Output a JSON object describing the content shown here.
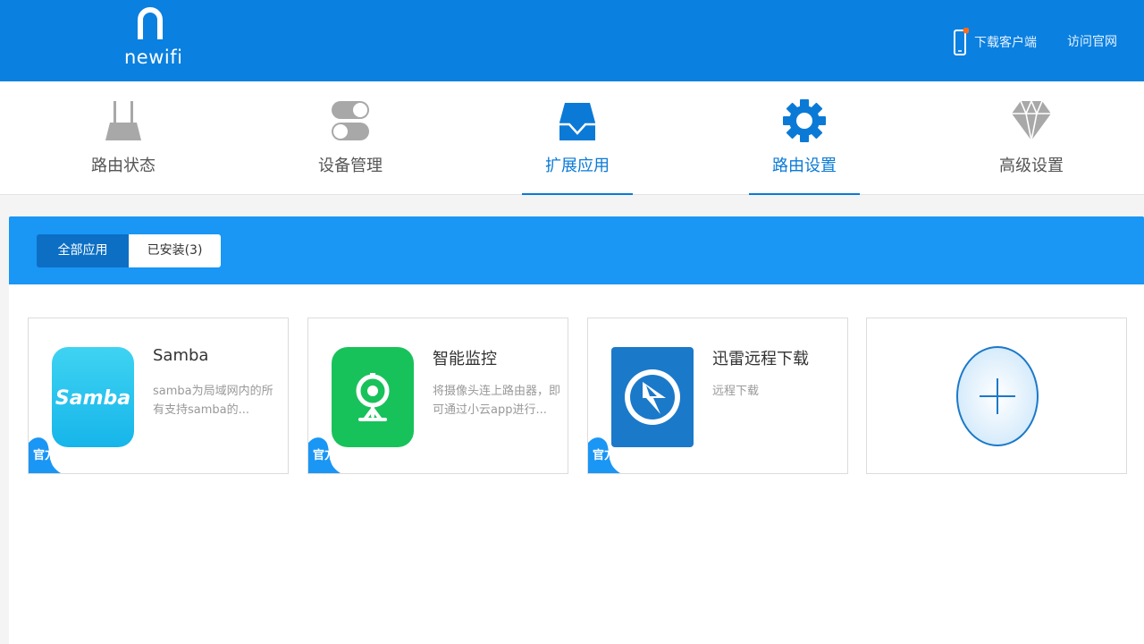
{
  "header": {
    "logo_text": "newifi",
    "download_client": "下载客户端",
    "official_site": "访问官网",
    "bg_color": "#0a80e0"
  },
  "nav": {
    "items": [
      {
        "label": "路由状态",
        "icon": "router-icon"
      },
      {
        "label": "设备管理",
        "icon": "toggle-switches-icon"
      },
      {
        "label": "扩展应用",
        "icon": "inbox-tray-icon"
      },
      {
        "label": "路由设置",
        "icon": "gear-icon"
      },
      {
        "label": "高级设置",
        "icon": "diamond-icon"
      }
    ],
    "accent_color": "#0a7ad6"
  },
  "tabs": {
    "all_label": "全部应用",
    "installed_label": "已安装(3)"
  },
  "apps": [
    {
      "title": "Samba",
      "desc": "samba为局域网内的所有支持samba的...",
      "badge": "官方",
      "icon": "samba-icon",
      "icon_text": "Samba"
    },
    {
      "title": "智能监控",
      "desc": "将摄像头连上路由器，即可通过小云app进行...",
      "badge": "官方",
      "icon": "webcam-icon"
    },
    {
      "title": "迅雷远程下载",
      "desc": "远程下载",
      "badge": "官方",
      "icon": "xunlei-icon"
    }
  ],
  "add_card": {
    "icon": "plus-icon"
  }
}
